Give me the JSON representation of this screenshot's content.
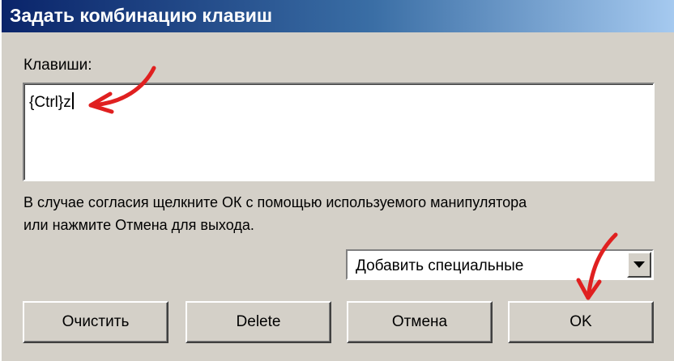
{
  "window": {
    "title": "Задать комбинацию клавиш"
  },
  "keys": {
    "label": "Клавиши:",
    "value": "{Ctrl}z"
  },
  "instructions": {
    "line1": "В случае согласия щелкните ОК с помощью используемого манипулятора",
    "line2": "или нажмите Отмена для выхода."
  },
  "special": {
    "selected": "Добавить специальные"
  },
  "buttons": {
    "clear": "Очистить",
    "delete": "Delete",
    "cancel": "Отмена",
    "ok": "OK"
  },
  "colors": {
    "title_bar_start": "#0a246a",
    "title_bar_end": "#a6caf0",
    "window_face": "#d4d0c8",
    "annotation_arrow": "#e02020"
  },
  "icons": {
    "dropdown": "chevron-down-icon",
    "annotations": [
      "red-arrow-icon"
    ]
  }
}
